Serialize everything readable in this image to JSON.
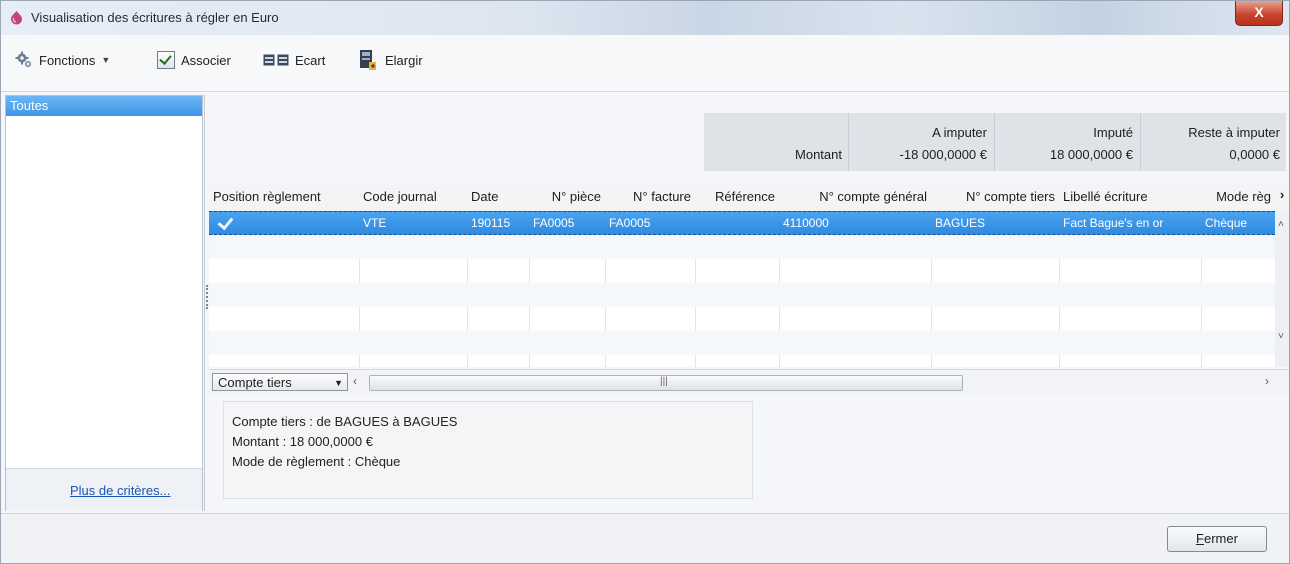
{
  "window": {
    "title": "Visualisation des écritures à régler en Euro",
    "close_label": "X"
  },
  "toolbar": {
    "fonctions_label": "Fonctions",
    "associer_label": "Associer",
    "ecart_label": "Ecart",
    "elargir_label": "Elargir"
  },
  "left_panel": {
    "selected_item": "Toutes",
    "more_criteria_link": "Plus de critères..."
  },
  "totals": {
    "montant_label": "Montant",
    "a_imputer_label": "A imputer",
    "a_imputer_value": "-18 000,0000 €",
    "impute_label": "Imputé",
    "impute_value": "18 000,0000 €",
    "reste_label": "Reste à imputer",
    "reste_value": "0,0000 €"
  },
  "grid": {
    "columns": [
      "Position règlement",
      "Code journal",
      "Date",
      "N° pièce",
      "N° facture",
      "Référence",
      "N° compte général",
      "N° compte tiers",
      "Libellé écriture",
      "Mode règ"
    ],
    "rows": [
      {
        "position": "checked",
        "code_journal": "VTE",
        "date": "190115",
        "piece": "FA0005",
        "facture": "FA0005",
        "reference": "",
        "compte_general": "4110000",
        "compte_tiers": "BAGUES",
        "libelle": "Fact Bague's en or",
        "mode": "Chèque"
      }
    ],
    "group_combo": "Compte tiers"
  },
  "summary": {
    "line1": "Compte tiers : de BAGUES à BAGUES",
    "line2": "Montant : 18 000,0000 €",
    "line3": "Mode de règlement : Chèque"
  },
  "footer": {
    "close_button": "Fermer",
    "close_button_rest": "ermer",
    "close_button_first": "F"
  }
}
